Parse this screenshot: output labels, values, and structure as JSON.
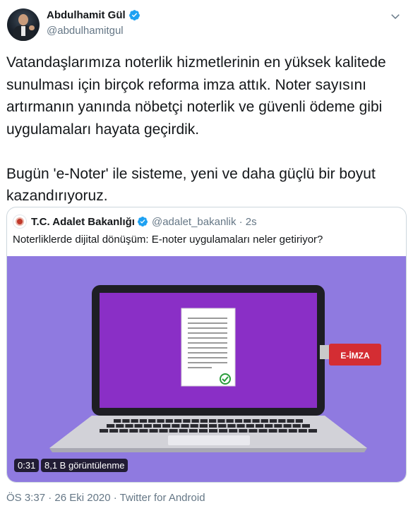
{
  "author": {
    "display_name": "Abdulhamit Gül",
    "handle": "@abdulhamitgul"
  },
  "tweet": {
    "text": "Vatandaşlarımıza noterlik hizmetlerinin en yüksek kalitede sunulması için birçok reforma imza attık. Noter sayısını artırmanın yanında nöbetçi noterlik ve güvenli ödeme gibi uygulamaları hayata geçirdik.\n\nBugün 'e-Noter' ile sisteme, yeni ve daha güçlü bir boyut kazandırıyoruz."
  },
  "quoted": {
    "display_name": "T.C. Adalet Bakanlığı",
    "handle_time": "@adalet_bakanlik · 2s",
    "text": "Noterliklerde dijital dönüşüm: E-noter uygulamaları neler getiriyor?",
    "video_duration": "0:31",
    "video_views": "8,1 B görüntülenme",
    "illustration_label": "E-İMZA"
  },
  "footer": {
    "meta": "ÖS 3:37 · 26 Eki 2020 · Twitter for Android"
  },
  "colors": {
    "verified": "#1da1f2",
    "media_bg": "#8f7ae0",
    "screen": "#8a2fc6",
    "eimza": "#d42d33"
  },
  "icons": [
    "verified-badge-icon",
    "chevron-down-icon",
    "gov-seal-logo",
    "check-circle-icon"
  ]
}
